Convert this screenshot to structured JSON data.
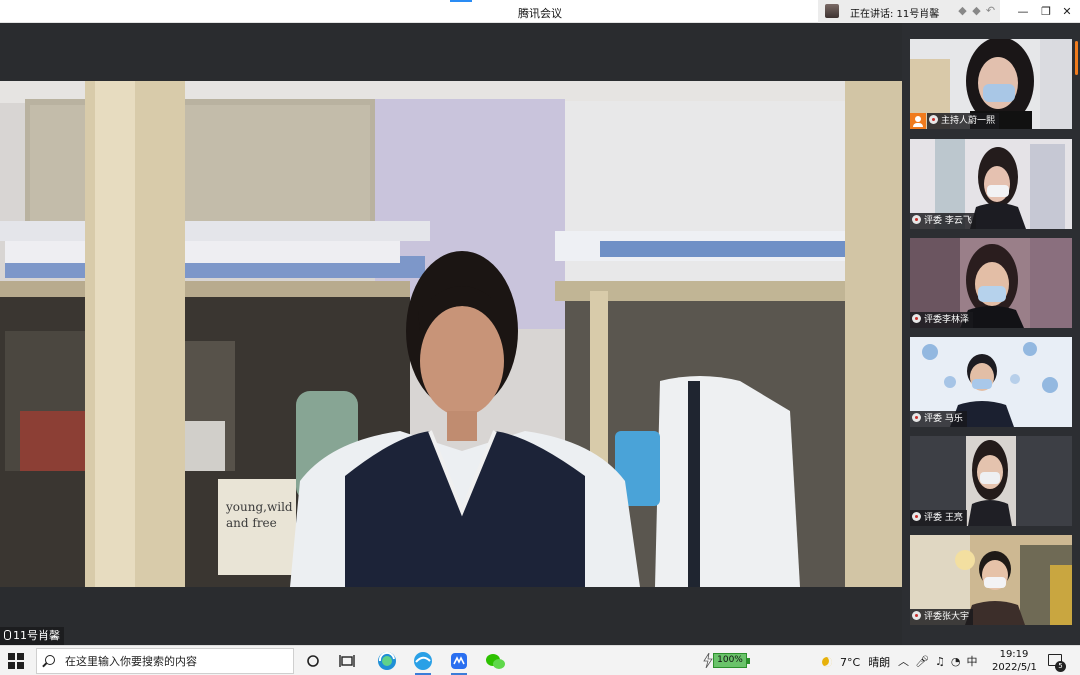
{
  "window": {
    "title": "腾讯会议",
    "speaking_label": "正在讲话: 11号肖馨",
    "minimize_icon": "—",
    "restore_icon": "❐",
    "close_icon": "✕"
  },
  "main_video": {
    "participant_name": "11号肖馨",
    "bag_text": [
      "young,wild",
      "and free"
    ]
  },
  "sidebar": {
    "participants": [
      {
        "name": "主持人蔚一熙",
        "role": "host"
      },
      {
        "name": "评委 李云飞",
        "role": "judge"
      },
      {
        "name": "评委李林泽",
        "role": "judge"
      },
      {
        "name": "评委 马乐",
        "role": "judge"
      },
      {
        "name": "评委 王亮",
        "role": "judge"
      },
      {
        "name": "评委张大宇",
        "role": "judge"
      }
    ]
  },
  "taskbar": {
    "search_placeholder": "在这里输入你要搜索的内容",
    "battery_percent": "100%",
    "weather_temp": "7°C",
    "weather_condition": "晴朗",
    "ime_label": "中",
    "time": "19:19",
    "date": "2022/5/1",
    "notification_count": "5"
  },
  "colors": {
    "accent_orange": "#f07b1d",
    "sidebar_bg": "#2c2e32",
    "stage_bg": "#2a2c2f",
    "battery_green": "#6ac36a"
  }
}
